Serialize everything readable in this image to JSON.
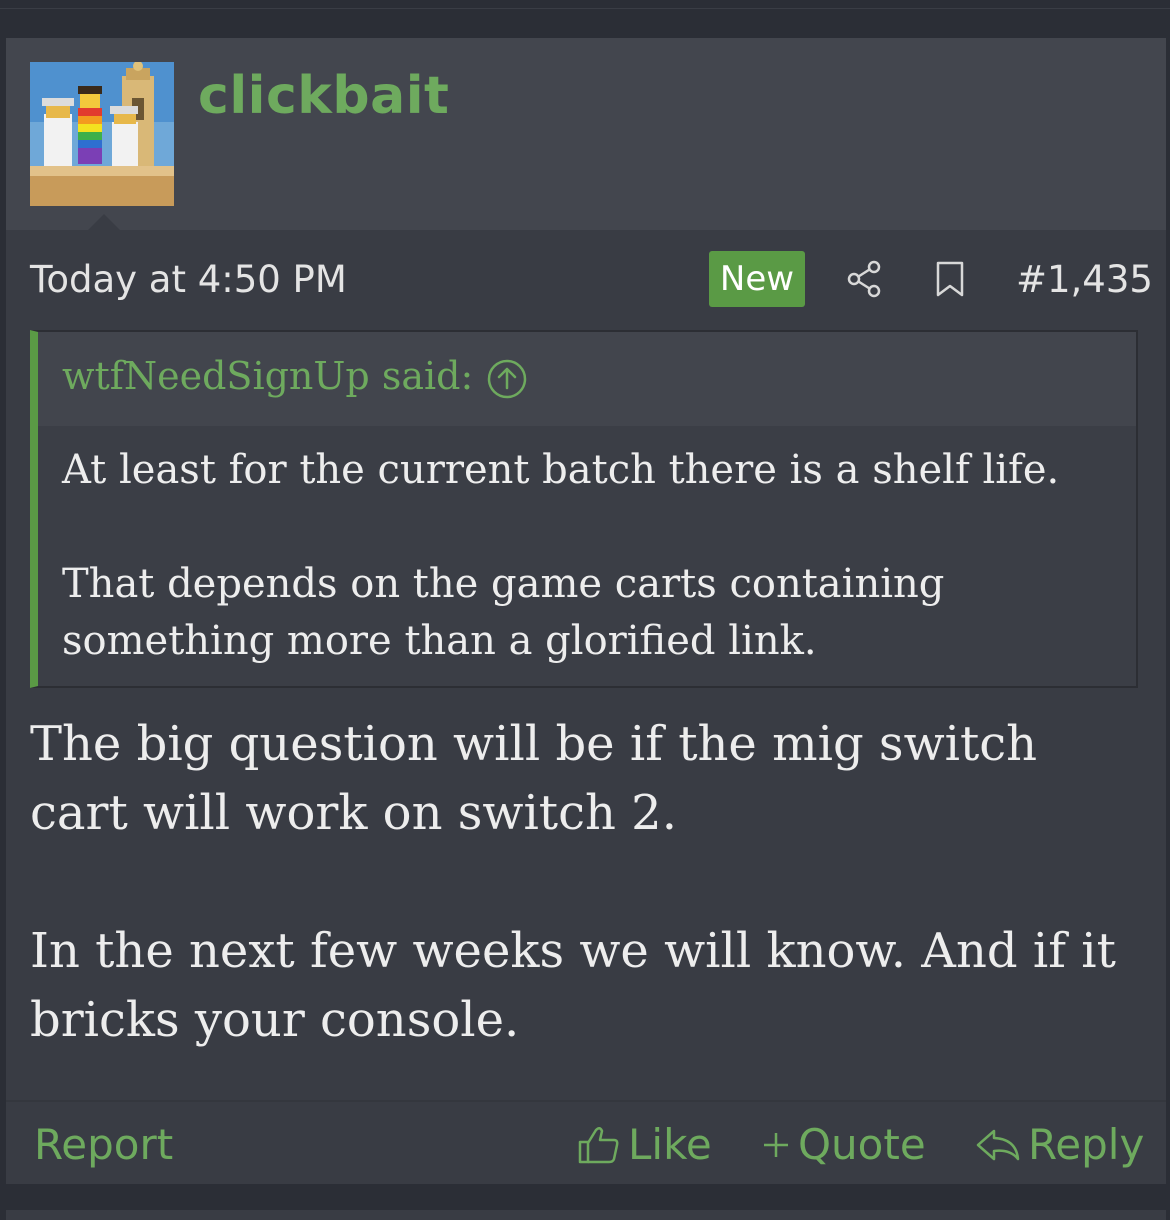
{
  "user": {
    "name": "clickbait"
  },
  "meta": {
    "date": "Today at 4:50 PM",
    "new_badge": "New",
    "post_number": "#1,435"
  },
  "quote": {
    "author": "wtfNeedSignUp said:",
    "paragraphs": [
      "At least for the current batch there is a shelf life.",
      "That depends on the game carts containing something more than a glorified link."
    ]
  },
  "body": {
    "paragraphs": [
      "The big question will be if the mig switch cart will work on switch 2.",
      "In the next few weeks we will know. And if it bricks your console."
    ]
  },
  "footer": {
    "report": "Report",
    "like": "Like",
    "quote": "Quote",
    "reply": "Reply"
  },
  "colors": {
    "accent": "#6eaa5e",
    "badge": "#5a9a45",
    "post_bg": "#393c44",
    "header_bg": "#43464e"
  }
}
